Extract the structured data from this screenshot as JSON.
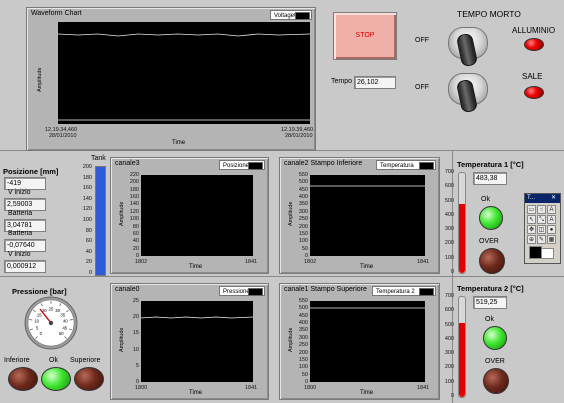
{
  "waveform_chart": {
    "title": "Waveform Chart",
    "legend": "Voltage0",
    "y_label": "Amplitude",
    "x_label": "Time",
    "x_start": "12.19.34,460",
    "x_start_date": "28/01/2010",
    "x_end": "12.19.39,460",
    "x_end_date": "28/01/2010",
    "ticks": [
      "",
      "",
      "",
      "",
      "",
      ""
    ]
  },
  "stop_label": "STOP",
  "tempo": {
    "label": "Tempo",
    "value": "26,102"
  },
  "tempo_morto": {
    "title": "TEMPO  MORTO",
    "switch1_label": "OFF",
    "switch2_label": "OFF"
  },
  "indicators": {
    "alluminio_label": "ALLUMINIO",
    "sale_label": "SALE"
  },
  "left_panel": {
    "posizione_label": "Posizione [mm]",
    "posizione_value": "-419",
    "v_inizio_label": "V inizio",
    "v_inizio_value": "2,59003",
    "batteria1_label": "Batteria",
    "batteria1_value": "3,04781",
    "batteria2_label": "Batteria",
    "batteria2_value": "-0,07640",
    "v_inizio2_label": "V inizio",
    "v_inizio2_value": "0,000912"
  },
  "tank": {
    "label": "Tank",
    "ticks": [
      "0",
      "20",
      "40",
      "60",
      "80",
      "100",
      "120",
      "140",
      "160",
      "180",
      "200"
    ],
    "level_fraction": 1.0
  },
  "canale3": {
    "title": "canale3",
    "legend": "Posizione",
    "y_label": "Amplitude",
    "x_label": "Time",
    "x_start": "1802",
    "x_end": "1841",
    "yticks": [
      "220",
      "200",
      "180",
      "160",
      "140",
      "120",
      "100",
      "80",
      "60",
      "40",
      "20",
      "0"
    ]
  },
  "canale2": {
    "title": "canale2 Stampo Inferiore",
    "legend": "Temperatura",
    "y_label": "Amplitude",
    "x_label": "Time",
    "x_start": "1802",
    "x_end": "1841",
    "yticks": [
      "550",
      "500",
      "450",
      "400",
      "350",
      "300",
      "250",
      "200",
      "150",
      "100",
      "50",
      "0"
    ]
  },
  "temp1": {
    "label": "Temperatura 1 [°C]",
    "value": "483,38",
    "ticks": [
      "700",
      "600",
      "500",
      "400",
      "300",
      "200",
      "100",
      "0"
    ],
    "level_fraction": 0.69,
    "ok_label": "Ok",
    "over_label": "OVER"
  },
  "tools_palette": {
    "title": "T..."
  },
  "pressione": {
    "label": "Pressione [bar]",
    "dial_ticks": [
      "0",
      "5",
      "10",
      "15",
      "20",
      "25",
      "30",
      "35",
      "40",
      "45",
      "50"
    ],
    "inferiore_label": "Inferiore",
    "ok_label": "Ok",
    "superiore_label": "Superiore"
  },
  "canale0": {
    "title": "canale0",
    "legend": "Pressione",
    "y_label": "Amplitude",
    "x_label": "Time",
    "x_start": "1800",
    "x_end": "1841",
    "yticks": [
      "25",
      "20",
      "15",
      "10",
      "5",
      "0"
    ]
  },
  "canale1": {
    "title": "canale1 Stampo Superiore",
    "legend": "Temperatura 2",
    "y_label": "Amplitude",
    "x_label": "Time",
    "x_start": "1800",
    "x_end": "1841",
    "yticks": [
      "550",
      "500",
      "450",
      "400",
      "350",
      "300",
      "250",
      "200",
      "150",
      "100",
      "50",
      "0"
    ]
  },
  "temp2": {
    "label": "Temperatura 2 [°C]",
    "value": "519,25",
    "ticks": [
      "700",
      "600",
      "500",
      "400",
      "300",
      "200",
      "100",
      "0"
    ],
    "level_fraction": 0.74,
    "ok_label": "Ok",
    "over_label": "OVER"
  }
}
